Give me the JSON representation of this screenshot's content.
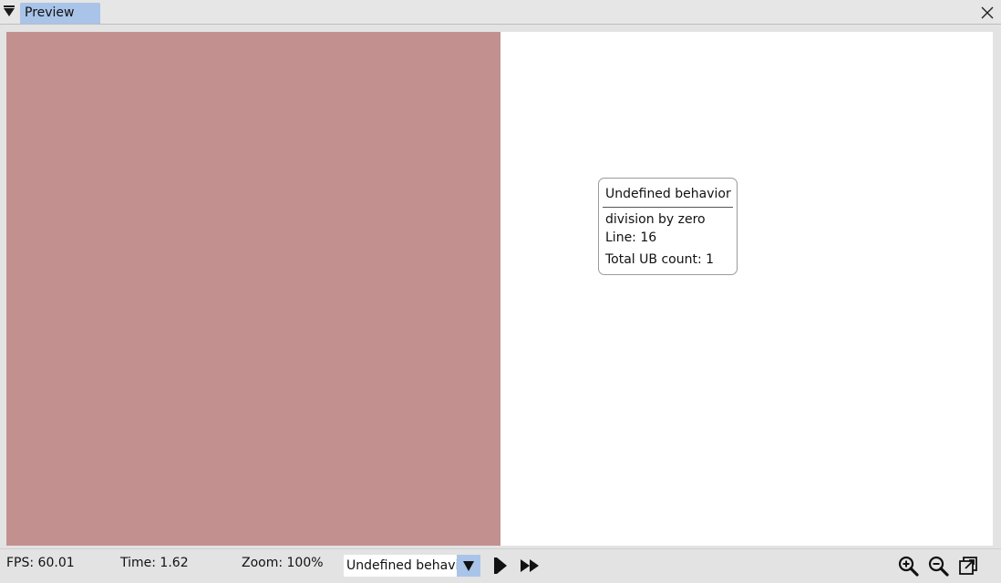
{
  "titlebar": {
    "tab_label": "Preview"
  },
  "canvas": {
    "fill_color": "#c39090",
    "background_color": "#ffffff"
  },
  "ub_panel": {
    "title": "Undefined behavior",
    "message": "division by zero",
    "line": "Line: 16",
    "total": "Total UB count: 1"
  },
  "statusbar": {
    "fps": "FPS: 60.01",
    "time": "Time: 1.62",
    "zoom": "Zoom: 100%",
    "mode_select_value": "Undefined behavior",
    "accent_color": "#a9c4e8"
  },
  "icons": {
    "menu": "menu-arrow-icon",
    "close": "close-icon",
    "play": "play-icon",
    "fast_forward": "fast-forward-icon",
    "zoom_in": "zoom-in-icon",
    "zoom_out": "zoom-out-icon",
    "detach": "detach-window-icon"
  }
}
